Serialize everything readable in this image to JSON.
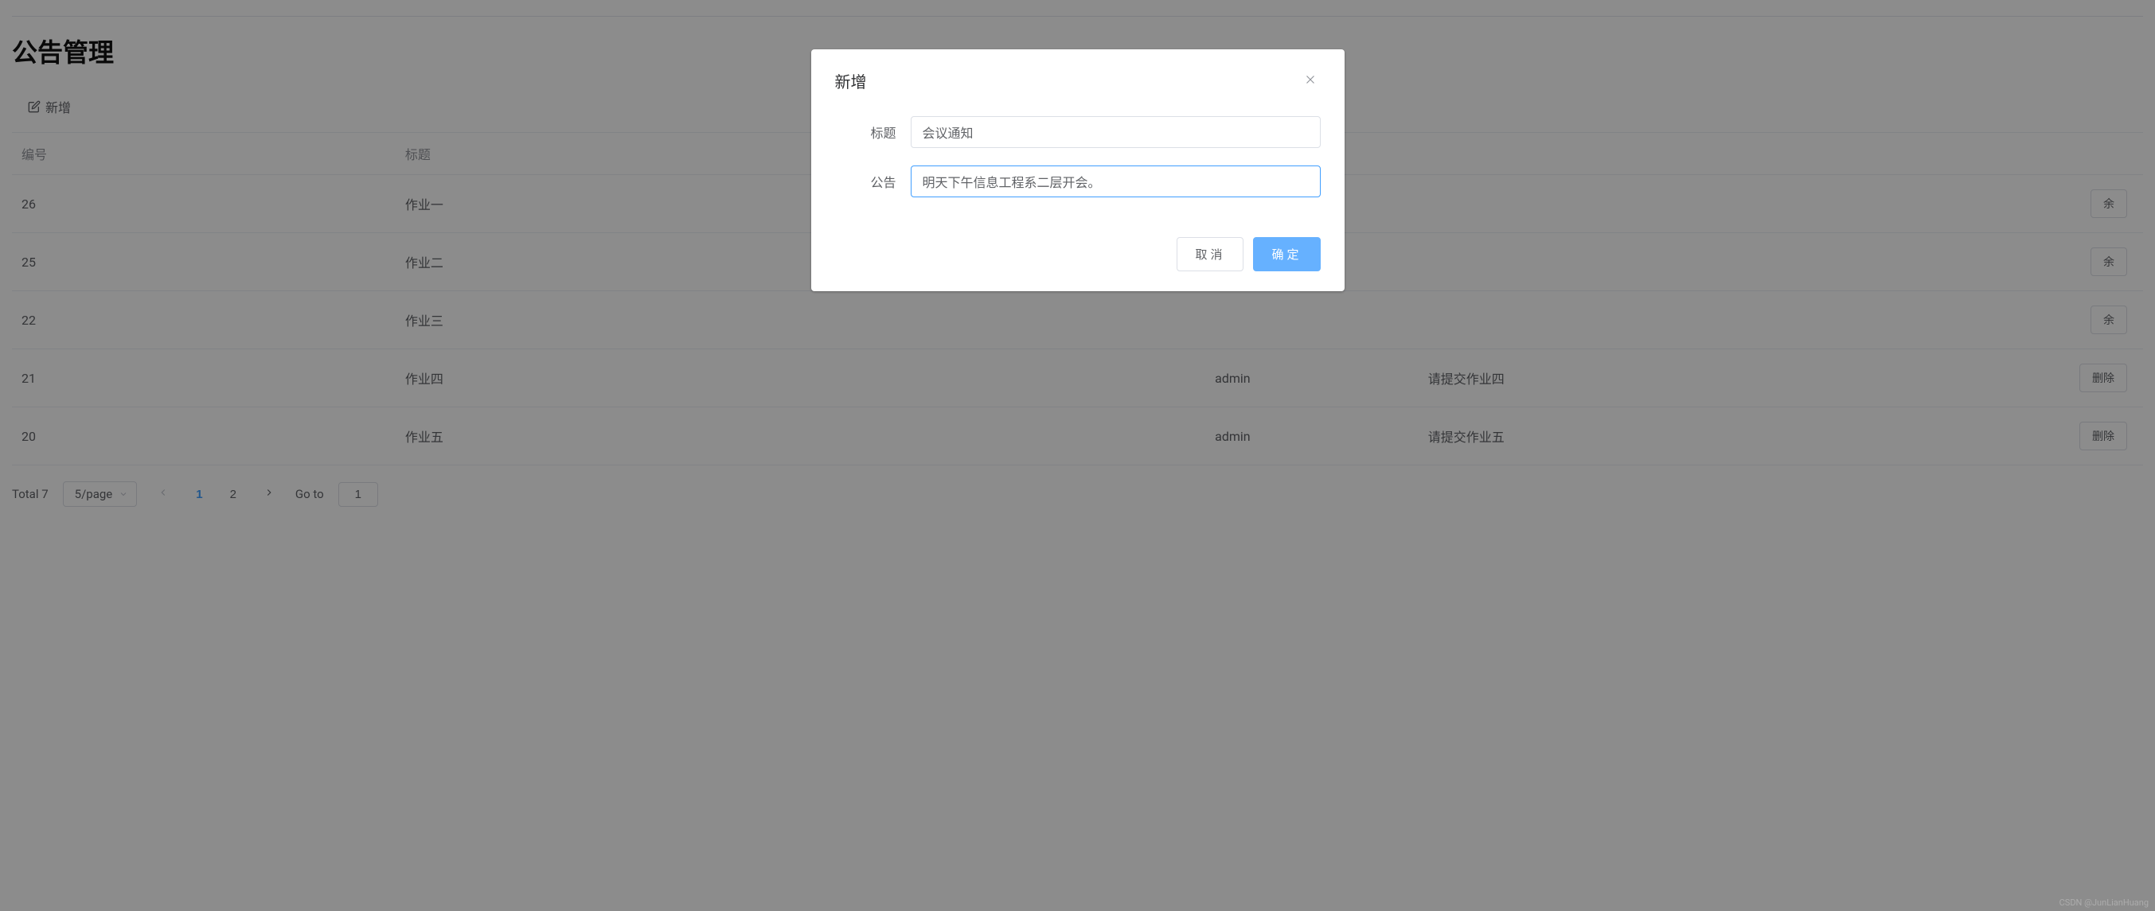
{
  "page": {
    "title": "公告管理",
    "add_button_label": "新增"
  },
  "table": {
    "headers": {
      "id": "编号",
      "title": "标题",
      "user": "",
      "content": "",
      "action": ""
    },
    "rows": [
      {
        "id": "26",
        "title": "作业一",
        "user": "",
        "content": "",
        "delete_label": "余"
      },
      {
        "id": "25",
        "title": "作业二",
        "user": "",
        "content": "",
        "delete_label": "余"
      },
      {
        "id": "22",
        "title": "作业三",
        "user": "",
        "content": "",
        "delete_label": "余"
      },
      {
        "id": "21",
        "title": "作业四",
        "user": "admin",
        "content": "请提交作业四",
        "delete_label": "删除"
      },
      {
        "id": "20",
        "title": "作业五",
        "user": "admin",
        "content": "请提交作业五",
        "delete_label": "删除"
      }
    ]
  },
  "pagination": {
    "total_label": "Total 7",
    "page_size_label": "5/page",
    "page_1": "1",
    "page_2": "2",
    "goto_label": "Go to",
    "goto_value": "1"
  },
  "dialog": {
    "title": "新增",
    "field_title_label": "标题",
    "field_title_value": "会议通知",
    "field_content_label": "公告",
    "field_content_value": "明天下午信息工程系二层开会。",
    "cancel_label": "取消",
    "confirm_label": "确定"
  },
  "watermark": "CSDN @JunLianHuang"
}
